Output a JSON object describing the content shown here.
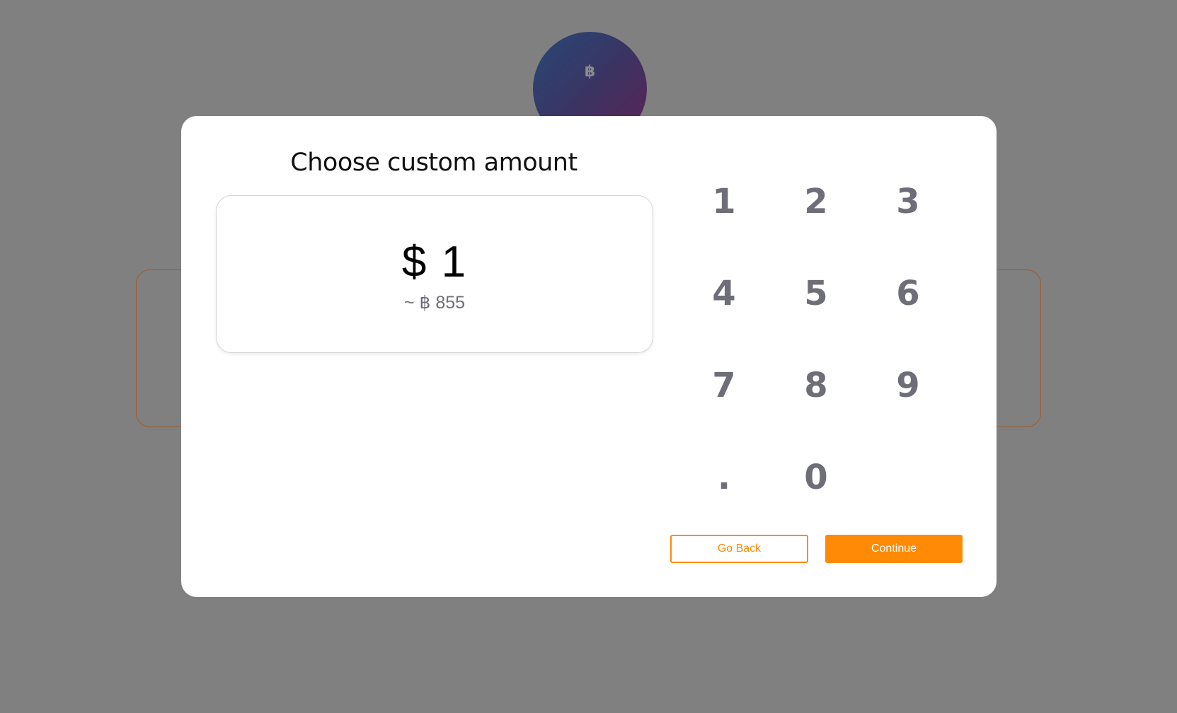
{
  "background": {
    "avatar_symbol": "฿"
  },
  "modal": {
    "title": "Choose custom amount",
    "amount": {
      "primary": "$ 1",
      "secondary": "~ ฿ 855"
    },
    "keypad": {
      "keys": [
        "1",
        "2",
        "3",
        "4",
        "5",
        "6",
        "7",
        "8",
        "9",
        ".",
        "0"
      ]
    },
    "buttons": {
      "back_label": "Go Back",
      "continue_label": "Continue"
    }
  },
  "colors": {
    "accent": "#ff8a05",
    "overlay": "#808080",
    "key_text": "#6e6e78"
  }
}
